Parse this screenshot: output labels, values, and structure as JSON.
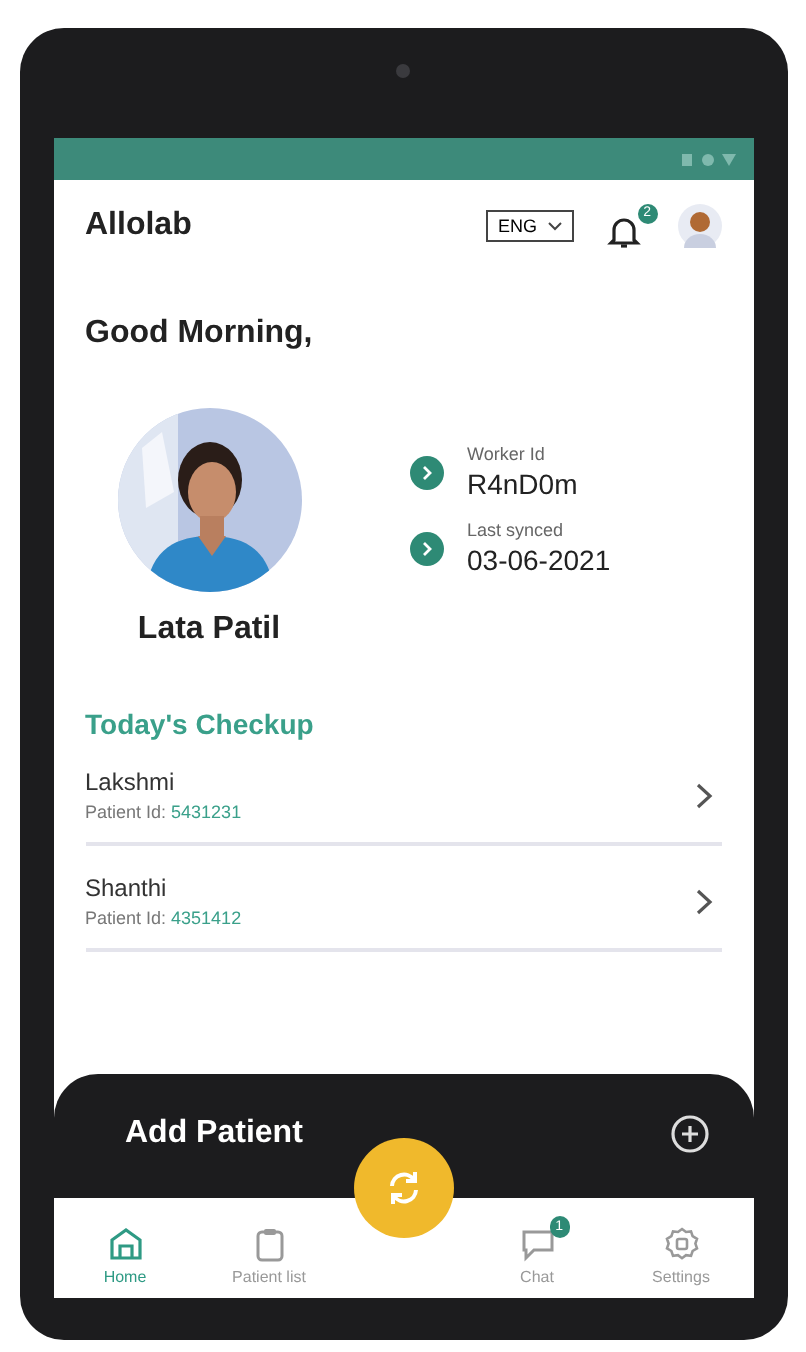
{
  "app_bar": {
    "title": "Allolab",
    "language": "ENG",
    "notification_badge": "2"
  },
  "greeting": "Good Morning,",
  "profile": {
    "name": "Lata Patil",
    "details": [
      {
        "label": "Worker Id",
        "value": "R4nD0m"
      },
      {
        "label": "Last synced",
        "value": "03-06-2021"
      }
    ]
  },
  "checkup": {
    "title": "Today's Checkup",
    "patients": [
      {
        "name": "Lakshmi",
        "id_label": "Patient Id:",
        "id": "5431231"
      },
      {
        "name": "Shanthi",
        "id_label": "Patient Id:",
        "id": "4351412"
      }
    ]
  },
  "add_patient": {
    "label": "Add Patient"
  },
  "bottom_nav": [
    {
      "label": "Home",
      "kind": "home",
      "selected": true
    },
    {
      "label": "Patient list",
      "kind": "list",
      "selected": false
    },
    {
      "label": "Chat",
      "kind": "chat",
      "selected": false,
      "badge": "1"
    },
    {
      "label": "Settings",
      "kind": "settings",
      "selected": false
    }
  ]
}
